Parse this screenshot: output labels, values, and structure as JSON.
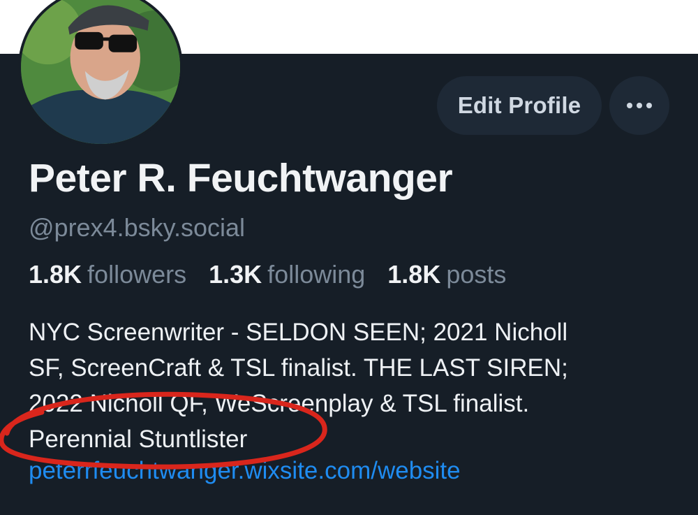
{
  "profile": {
    "display_name": "Peter R. Feuchtwanger",
    "handle": "@prex4.bsky.social",
    "stats": {
      "followers_count": "1.8K",
      "followers_label": "followers",
      "following_count": "1.3K",
      "following_label": "following",
      "posts_count": "1.8K",
      "posts_label": "posts"
    },
    "bio_lines": [
      "NYC Screenwriter - SELDON SEEN; 2021 Nicholl",
      "SF, ScreenCraft & TSL finalist. THE LAST SIREN;",
      "2022 Nicholl QF, WeScreenplay & TSL finalist.",
      "Perennial Stuntlister"
    ],
    "website": "peterrfeuchtwanger.wixsite.com/website"
  },
  "actions": {
    "edit_profile_label": "Edit Profile",
    "more_icon": "ellipsis-icon"
  },
  "colors": {
    "background": "#161e27",
    "button_bg": "#1e2936",
    "link": "#1f8cf1",
    "muted": "#7c8a99",
    "annotation": "#d9261c"
  }
}
